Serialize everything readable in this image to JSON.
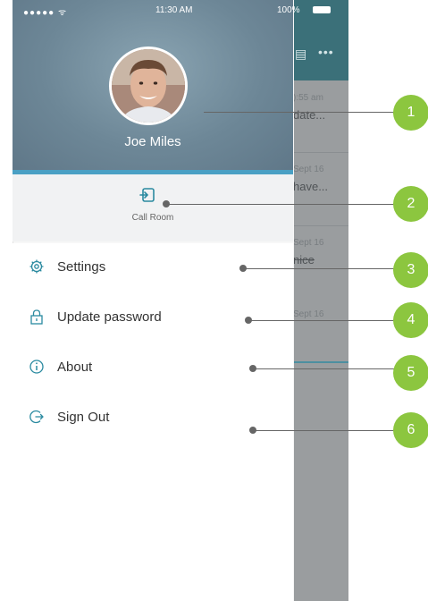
{
  "status_bar": {
    "carrier": "●●●●● ᯤ",
    "time": "11:30 AM",
    "battery": "100%"
  },
  "profile": {
    "name": "Joe Miles"
  },
  "call_room": {
    "label": "Call Room"
  },
  "menu": [
    {
      "label": "Settings",
      "icon": "gear-icon"
    },
    {
      "label": "Update password",
      "icon": "lock-icon"
    },
    {
      "label": "About",
      "icon": "info-icon"
    },
    {
      "label": "Sign Out",
      "icon": "sign-out-icon"
    }
  ],
  "background_app": {
    "header_icons": [
      "calendar-icon",
      "more-icon"
    ],
    "rows": [
      {
        "time": "):55 am",
        "snippet": "date..."
      },
      {
        "time": "Sept 16",
        "snippet": "have..."
      },
      {
        "time": "Sept 16",
        "snippet": "nice"
      },
      {
        "time": "Sept 16",
        "snippet": ""
      }
    ]
  },
  "callouts": [
    "1",
    "2",
    "3",
    "4",
    "5",
    "6"
  ],
  "colors": {
    "badge": "#8cc63f",
    "accent_strip": "#4aa0c4",
    "app_header": "#3b7079"
  }
}
